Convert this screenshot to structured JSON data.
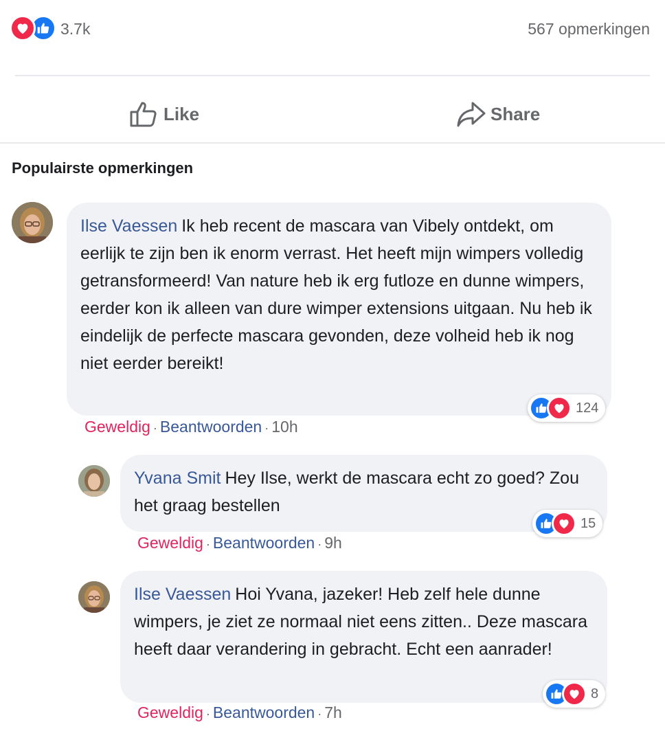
{
  "summary": {
    "reaction_count": "3.7k",
    "comments_count": "567 opmerkingen",
    "reactions": [
      "heart-icon",
      "like-icon"
    ]
  },
  "actions": {
    "like_label": "Like",
    "share_label": "Share"
  },
  "section_title": "Populairste opmerkingen",
  "comments": [
    {
      "author": "Ilse Vaessen",
      "text": "Ik heb recent de mascara van Vibely ontdekt, om eerlijk te zijn ben ik enorm verrast. Het heeft mijn wimpers volledig getransformeerd! Van nature heb ik erg futloze en dunne wimpers, eerder kon ik alleen van dure wimper extensions uitgaan. Nu heb ik eindelijk de perfecte mascara gevonden, deze volheid heb ik nog niet eerder bereikt!",
      "react_label": "Geweldig",
      "reply_label": "Beantwoorden",
      "time": "10h",
      "reaction_count": "124"
    },
    {
      "author": "Yvana Smit",
      "text": "Hey Ilse, werkt de mascara echt zo goed? Zou het graag bestellen",
      "react_label": "Geweldig",
      "reply_label": "Beantwoorden",
      "time": "9h",
      "reaction_count": "15"
    },
    {
      "author": "Ilse Vaessen",
      "text": "Hoi Yvana, jazeker! Heb zelf hele dunne wimpers, je ziet ze normaal niet eens zitten.. Deze mascara heeft daar verandering in gebracht. Echt een aanrader!",
      "react_label": "Geweldig",
      "reply_label": "Beantwoorden",
      "time": "7h",
      "reaction_count": "8"
    }
  ],
  "colors": {
    "author_link": "#385898",
    "react_link": "#e0245e",
    "like_blue": "#1877f2",
    "heart_red": "#f0284a",
    "bubble_bg": "#f0f2f5",
    "muted_text": "#65676b"
  }
}
